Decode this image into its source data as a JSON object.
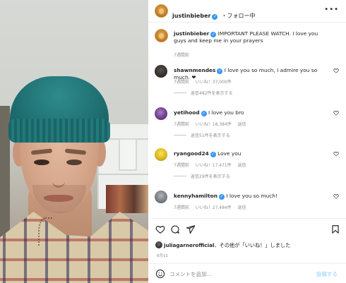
{
  "header": {
    "username": "justinbieber",
    "separator": "・",
    "follow_label": "フォロー中",
    "more_icon": "more-horizontal-icon"
  },
  "caption": {
    "username": "justinbieber",
    "text": "IMPORTANT PLEASE WATCH. I love you guys and keep me in your prayers",
    "time": "7週間前"
  },
  "comments": [
    {
      "username": "shawnmendes",
      "verified": true,
      "text": "I love you so much, I admire you so much. ❤",
      "time": "7週間前",
      "likes": "いいね！37,000件",
      "reply": "",
      "replies": "返信482件を表示する"
    },
    {
      "username": "yetihood",
      "verified": true,
      "text": "I love you bro",
      "time": "7週間前",
      "likes": "いいね！18,384件",
      "reply": "返信",
      "replies": "返信51件を表示する"
    },
    {
      "username": "ryangood24",
      "verified": true,
      "text": "Love you",
      "time": "7週間前",
      "likes": "いいね！17,471件",
      "reply": "返信",
      "replies": "返信29件を表示する"
    },
    {
      "username": "kennyhamilton",
      "verified": true,
      "text": "I love you so much!",
      "time": "7週間前",
      "likes": "いいね！27,484件",
      "reply": "返信",
      "replies": ""
    }
  ],
  "actions": {
    "liked_by_user": "juliagarnerofficial",
    "liked_suffix": "、その他が「いいね！」しました",
    "date": "6月11"
  },
  "add_comment": {
    "placeholder": "コメントを追加...",
    "post_label": "投稿する"
  },
  "colors": {
    "verified": "#3897f0",
    "muted": "#8e8e8e",
    "text": "#262626",
    "post_disabled": "#b2dffc"
  }
}
